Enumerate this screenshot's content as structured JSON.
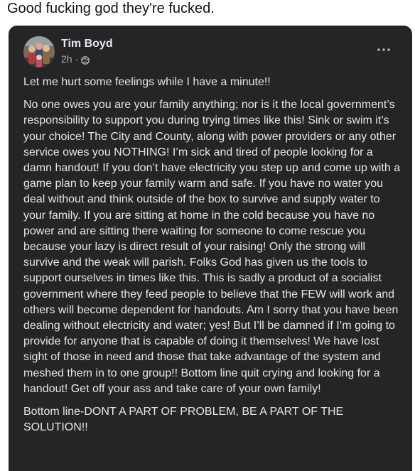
{
  "tweet": {
    "text": "Good fucking god they're fucked."
  },
  "post": {
    "author": "Tim Boyd",
    "time": "2h",
    "separator": "·",
    "audience_icon": "globe-icon",
    "more_icon": "more-horizontal-icon",
    "paragraphs": [
      "Let me hurt some feelings while I have a minute!!",
      "No one owes you are your family anything; nor is it the local government’s responsibility to support you during trying times like this! Sink or swim it’s your choice!  The City and County, along with power providers or any other service owes you NOTHING!  I’m sick and tired of people looking for a damn handout!  If you don’t have electricity you step up and come up with a game plan to keep your family warm and safe. If you have no water you deal without and think outside of the box to survive and supply water to your family. If you are sitting at home in the cold because you have no power and are sitting there waiting for someone to come rescue you because your lazy is direct result of your raising!  Only the strong will survive and the weak will parish. Folks God has given us the tools to support ourselves in times like this. This is sadly a product of a socialist government where they feed people to believe that the FEW will work and others will become dependent for handouts. Am I sorry that you have been dealing without electricity and water; yes! But I’ll be damned if I’m going to provide for anyone that is capable of doing it themselves!  We have lost sight of those in need and those that take advantage of the system and meshed them in to one group!! Bottom line quit crying and looking for a handout! Get off your ass and take care of your own family!",
      "Bottom line-DONT A PART OF PROBLEM, BE A PART OF THE SOLUTION!!"
    ]
  },
  "colors": {
    "card_background": "#242526",
    "primary_text": "#e4e6eb",
    "secondary_text": "#b0b3b8",
    "page_background": "#ffffff"
  }
}
